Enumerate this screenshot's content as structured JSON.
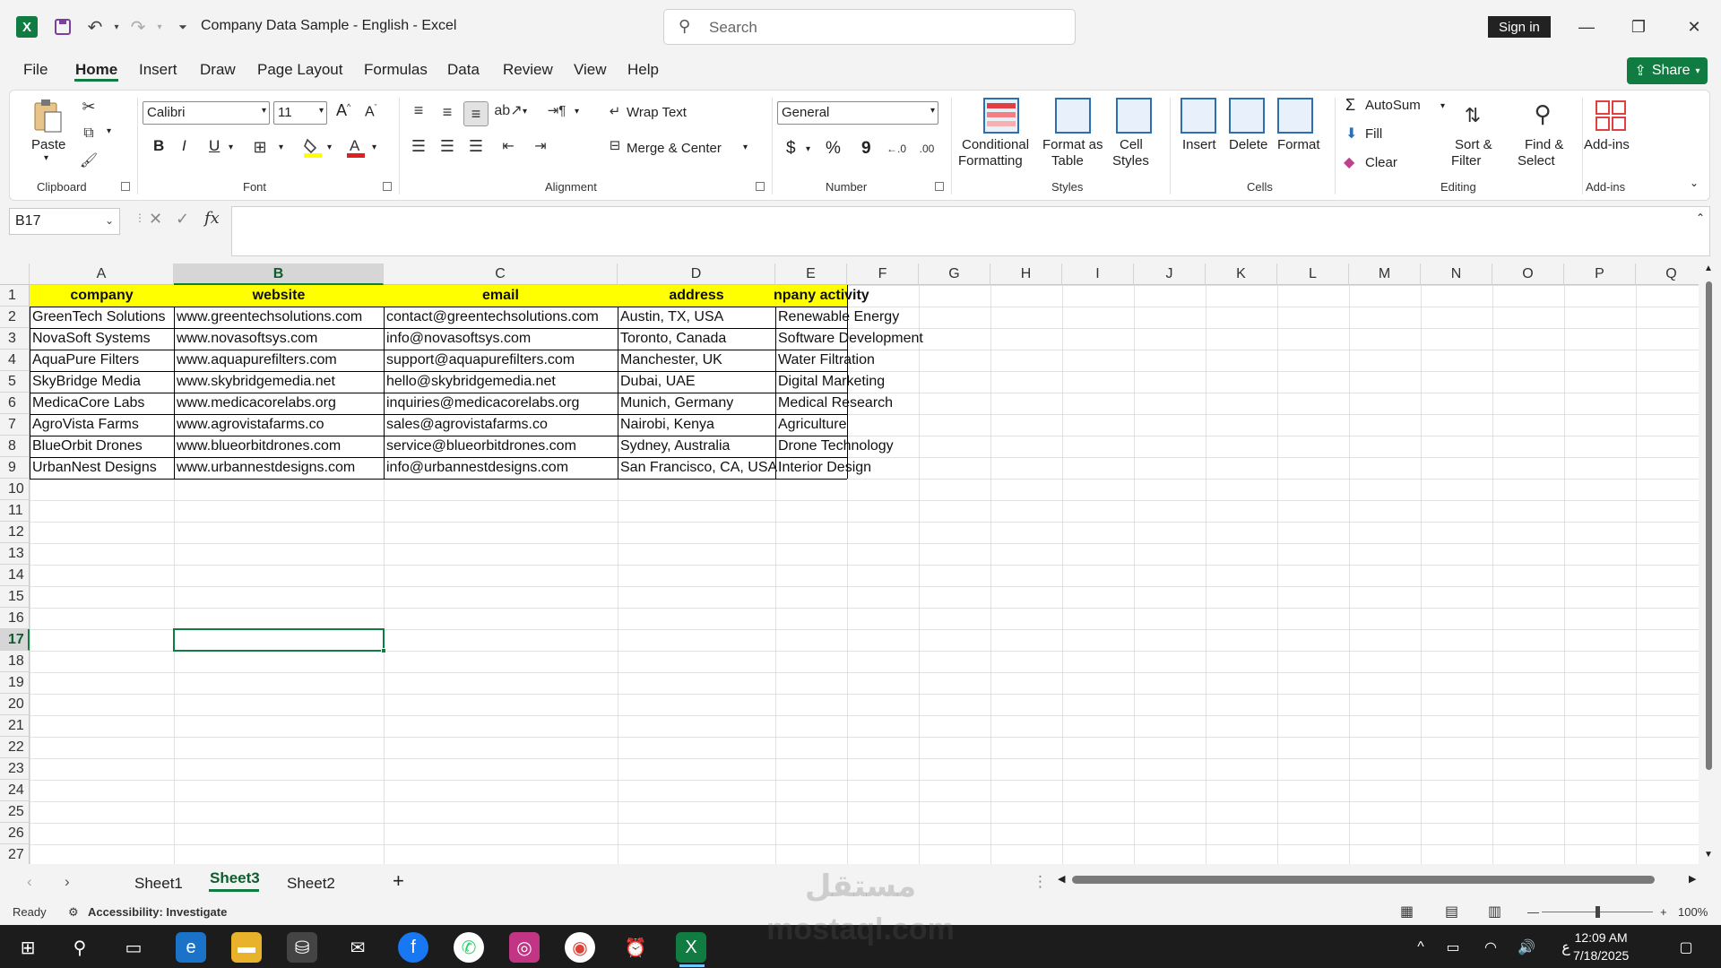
{
  "app": {
    "doc_title": "Company Data Sample - English  -  Excel",
    "search_placeholder": "Search",
    "sign_in": "Sign in",
    "share": "Share"
  },
  "menu": [
    "File",
    "Home",
    "Insert",
    "Draw",
    "Page Layout",
    "Formulas",
    "Data",
    "Review",
    "View",
    "Help"
  ],
  "ribbon": {
    "clipboard": {
      "paste": "Paste",
      "label": "Clipboard"
    },
    "font": {
      "name": "Calibri",
      "size": "11",
      "bold": "B",
      "italic": "I",
      "underline": "U",
      "label": "Font"
    },
    "alignment": {
      "wrap_text": "Wrap Text",
      "merge_center": "Merge & Center",
      "label": "Alignment"
    },
    "number": {
      "format": "General",
      "currency": "$",
      "percent": "%",
      "comma": "9",
      "label": "Number"
    },
    "styles": {
      "conditional": "Conditional",
      "formatting": "Formatting",
      "format_as": "Format as",
      "table": "Table",
      "cell": "Cell",
      "cell_styles": "Styles",
      "label": "Styles"
    },
    "cells": {
      "insert": "Insert",
      "delete": "Delete",
      "format": "Format",
      "label": "Cells"
    },
    "editing": {
      "autosum": "AutoSum",
      "fill": "Fill",
      "clear": "Clear",
      "sort": "Sort &",
      "filter": "Filter",
      "find": "Find &",
      "select": "Select",
      "label": "Editing"
    },
    "addins": {
      "addins": "Add-ins",
      "label": "Add-ins"
    }
  },
  "formula_bar": {
    "name_box": "B17",
    "fx": "fx",
    "value": ""
  },
  "grid": {
    "columns": [
      "A",
      "B",
      "C",
      "D",
      "E",
      "F",
      "G",
      "H",
      "I",
      "J",
      "K",
      "L",
      "M",
      "N",
      "O",
      "P",
      "Q"
    ],
    "selected_column": "B",
    "selected_row": 17,
    "rows": [
      "1",
      "2",
      "3",
      "4",
      "5",
      "6",
      "7",
      "8",
      "9",
      "10",
      "11",
      "12",
      "13",
      "14",
      "15",
      "16",
      "17",
      "18",
      "19",
      "20",
      "21",
      "22",
      "23",
      "24",
      "25",
      "26",
      "27"
    ],
    "header": [
      "company",
      "website",
      "email",
      "address",
      "npany activity"
    ],
    "data": [
      [
        "GreenTech Solutions",
        "www.greentechsolutions.com",
        "contact@greentechsolutions.com",
        "Austin, TX, USA",
        "Renewable Energy"
      ],
      [
        "NovaSoft Systems",
        "www.novasoftsys.com",
        "info@novasoftsys.com",
        "Toronto, Canada",
        "Software Development"
      ],
      [
        "AquaPure Filters",
        "www.aquapurefilters.com",
        "support@aquapurefilters.com",
        "Manchester, UK",
        "Water Filtration"
      ],
      [
        "SkyBridge Media",
        "www.skybridgemedia.net",
        "hello@skybridgemedia.net",
        "Dubai, UAE",
        "Digital Marketing"
      ],
      [
        "MedicaCore Labs",
        "www.medicacorelabs.org",
        "inquiries@medicacorelabs.org",
        "Munich, Germany",
        "Medical Research"
      ],
      [
        "AgroVista Farms",
        "www.agrovistafarms.co",
        "sales@agrovistafarms.co",
        "Nairobi, Kenya",
        "Agriculture"
      ],
      [
        "BlueOrbit Drones",
        "www.blueorbitdrones.com",
        "service@blueorbitdrones.com",
        "Sydney, Australia",
        "Drone Technology"
      ],
      [
        "UrbanNest Designs",
        "www.urbannestdesigns.com",
        "info@urbannestdesigns.com",
        "San Francisco, CA, USA",
        "Interior Design"
      ]
    ],
    "header_fill": "#ffff00"
  },
  "sheets": {
    "tabs": [
      "Sheet1",
      "Sheet3",
      "Sheet2"
    ],
    "active": "Sheet3",
    "add": "+"
  },
  "status": {
    "ready": "Ready",
    "accessibility": "Accessibility: Investigate",
    "zoom": "100%"
  },
  "taskbar": {
    "time": "12:09 AM",
    "date": "7/18/2025",
    "lang": "ع"
  },
  "watermark": {
    "line1": "مستقل",
    "line2": "mostaql.com"
  },
  "colors": {
    "accent": "#107c41",
    "header_fill": "#ffff00"
  }
}
